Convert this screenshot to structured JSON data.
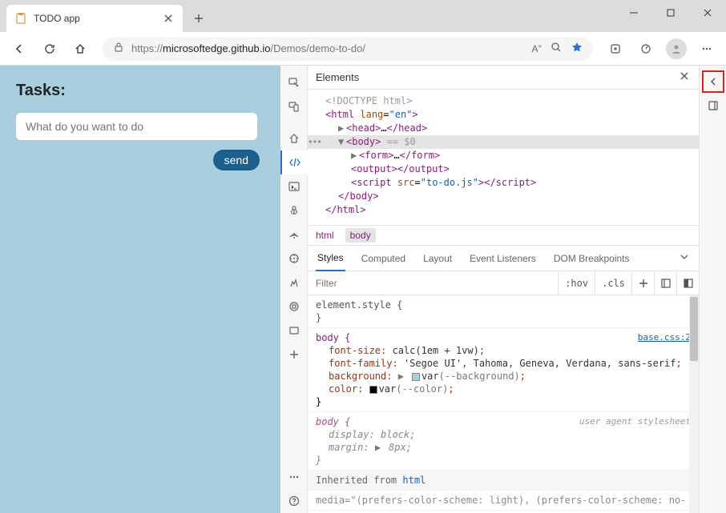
{
  "browser": {
    "tab_title": "TODO app",
    "url_prefix": "https://",
    "url_host": "microsoftedge.github.io",
    "url_path": "/Demos/demo-to-do/"
  },
  "page": {
    "heading": "Tasks:",
    "input_placeholder": "What do you want to do",
    "send_label": "send"
  },
  "devtools": {
    "panel_title": "Elements",
    "dom": {
      "doctype": "<!DOCTYPE html>",
      "html_open": "<",
      "html_tag": "html",
      "html_attr_name": "lang",
      "html_attr_val": "\"en\"",
      "head_open": "<",
      "head_tag": "head",
      "head_ellipsis": "…",
      "head_close": "</",
      "body_tag": "body",
      "body_meta": " == $0",
      "form_tag": "form",
      "form_ellipsis": "…",
      "output_tag": "output",
      "script_tag": "script",
      "script_attr_name": "src",
      "script_attr_val": "\"to-do.js\"",
      "body_close": "</",
      "html_close": "</"
    },
    "breadcrumb": {
      "html": "html",
      "body": "body"
    },
    "styles_tabs": {
      "styles": "Styles",
      "computed": "Computed",
      "layout": "Layout",
      "listeners": "Event Listeners",
      "dom_bp": "DOM Breakpoints"
    },
    "filter_placeholder": "Filter",
    "hov": ":hov",
    "cls": ".cls",
    "rules": {
      "element_style": "element.style {",
      "body_sel": "body {",
      "base_link": "base.css:2",
      "fs_name": "font-size",
      "fs_val": "calc(1em + 1vw)",
      "ff_name": "font-family",
      "ff_val": "'Segoe UI', Tahoma, Geneva, Verdana, sans-serif",
      "bg_name": "background",
      "bg_val_var": "var",
      "bg_val_ref": "(--background)",
      "col_name": "color",
      "col_val_var": "var",
      "col_val_ref": "(--color)",
      "uas_label": "user agent stylesheet",
      "disp_name": "display",
      "disp_val": "block",
      "marg_name": "margin",
      "marg_val": "8px",
      "inherited_from": "Inherited from ",
      "inherited_target": "html",
      "media_q": "media=\"(prefers-color-scheme: light), (prefers-color-scheme: no-"
    }
  },
  "colors": {
    "bg_swatch": "#a9cedd",
    "col_swatch": "#000000"
  }
}
